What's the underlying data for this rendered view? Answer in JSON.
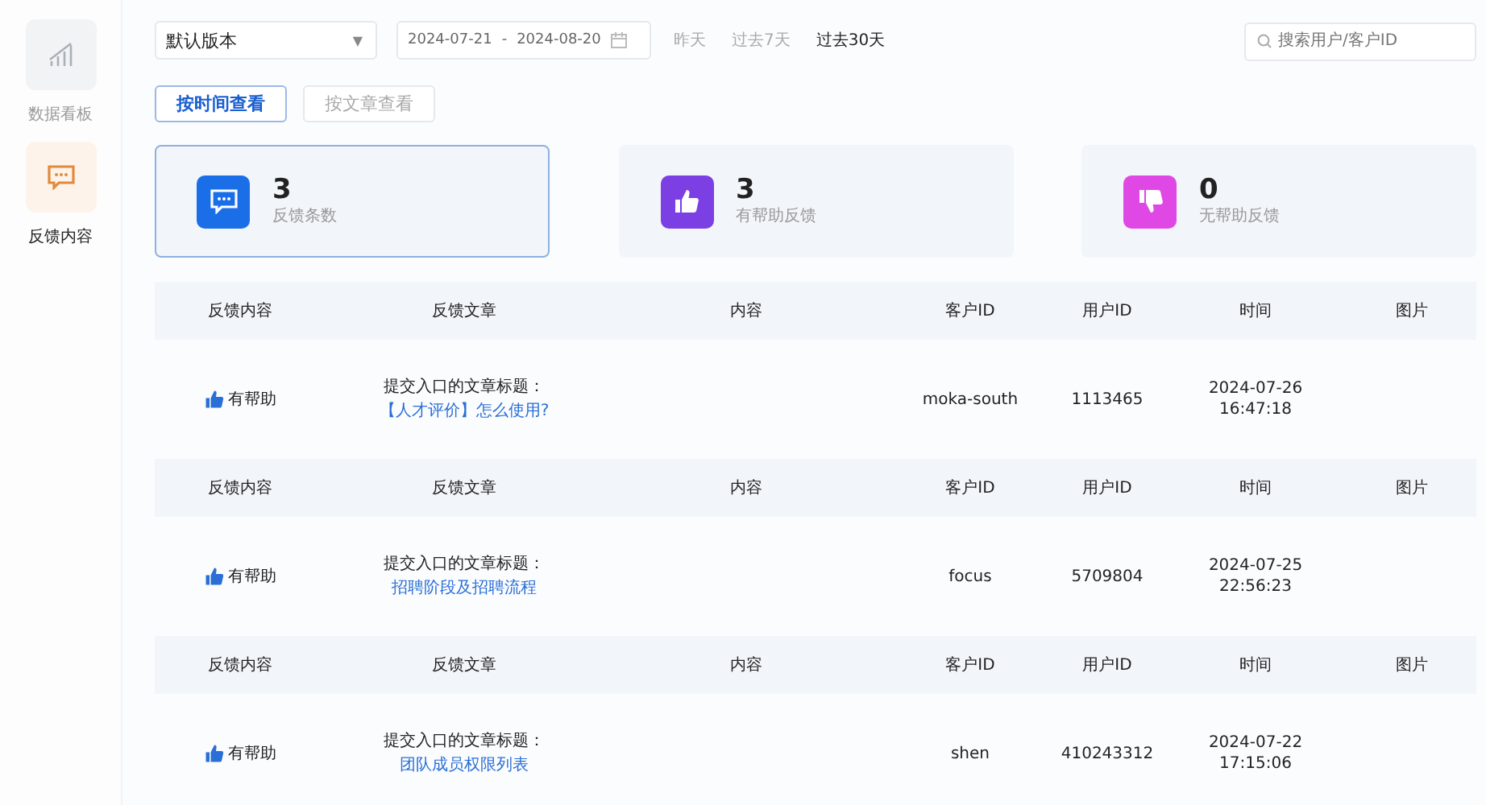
{
  "sidebar": {
    "items": [
      {
        "label": "数据看板",
        "kind": "chart",
        "selected": false
      },
      {
        "label": "反馈内容",
        "kind": "feedback",
        "selected": true
      }
    ]
  },
  "filters": {
    "version": "默认版本",
    "version_caret": "▼",
    "date_start": "2024-07-21",
    "date_separator": "-",
    "date_end": "2024-08-20",
    "quick_ranges": [
      {
        "label": "昨天",
        "selected": false
      },
      {
        "label": "过去7天",
        "selected": false
      },
      {
        "label": "过去30天",
        "selected": true
      }
    ],
    "search": {
      "placeholder": "搜索用户/客户ID"
    }
  },
  "view_tabs": [
    {
      "label": "按时间查看",
      "selected": true
    },
    {
      "label": "按文章查看",
      "selected": false
    }
  ],
  "stats": [
    {
      "kind": "total",
      "value": "3",
      "label": "反馈条数",
      "selected": true,
      "color": "#1a6fe8"
    },
    {
      "kind": "helpful",
      "value": "3",
      "label": "有帮助反馈",
      "selected": false,
      "color": "#7b3fe4"
    },
    {
      "kind": "unhelpful",
      "value": "0",
      "label": "无帮助反馈",
      "selected": false,
      "color": "#e048e6"
    }
  ],
  "table": {
    "records": [
      {
        "columns": [
          "反馈内容",
          "反馈文章",
          "内容",
          "客户ID",
          "用户ID",
          "时间",
          "图片"
        ],
        "feedback": {
          "kind": "helpful",
          "label": "有帮助"
        },
        "article_prefix": "提交入口的文章标题：",
        "article_title": "【人才评价】怎么使用?",
        "customer_id": "moka-south",
        "user_id": "1113465",
        "date": "2024-07-26",
        "time": "16:47:18"
      },
      {
        "columns": [
          "反馈内容",
          "反馈文章",
          "内容",
          "客户ID",
          "用户ID",
          "时间",
          "图片"
        ],
        "feedback": {
          "kind": "helpful",
          "label": "有帮助"
        },
        "article_prefix": "提交入口的文章标题：",
        "article_title": "招聘阶段及招聘流程",
        "customer_id": "focus",
        "user_id": "5709804",
        "date": "2024-07-25",
        "time": "22:56:23"
      },
      {
        "columns": [
          "反馈内容",
          "反馈文章",
          "内容",
          "客户ID",
          "用户ID",
          "时间",
          "图片"
        ],
        "feedback": {
          "kind": "helpful",
          "label": "有帮助"
        },
        "article_prefix": "提交入口的文章标题：",
        "article_title": "团队成员权限列表",
        "customer_id": "shen",
        "user_id": "410243312",
        "date": "2024-07-22",
        "time": "17:15:06"
      }
    ]
  }
}
